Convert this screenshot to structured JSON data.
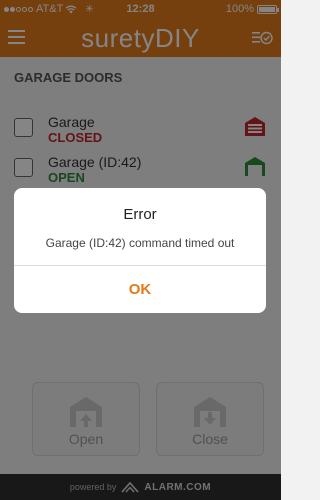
{
  "status_bar": {
    "carrier": "AT&T",
    "time": "12:28",
    "battery": "100%"
  },
  "header": {
    "brand_left": "surety",
    "brand_right": "DIY",
    "menu_icon": "hamburger-menu-icon",
    "task_icon": "task-check-icon"
  },
  "section": {
    "title": "GARAGE DOORS"
  },
  "doors": [
    {
      "name": "Garage",
      "status": "CLOSED",
      "status_color": "#c0282d",
      "icon": "garage-closed-icon"
    },
    {
      "name": "Garage (ID:42)",
      "status": "OPEN",
      "status_color": "#2e8b3a",
      "icon": "garage-open-icon"
    }
  ],
  "actions": {
    "open_label": "Open",
    "close_label": "Close"
  },
  "footer": {
    "powered_by": "powered by",
    "brand": "ALARM.COM"
  },
  "dialog": {
    "title": "Error",
    "message": "Garage (ID:42) command timed out",
    "ok_label": "OK"
  },
  "colors": {
    "accent": "#e2791c",
    "closed": "#c0282d",
    "open": "#2e8b3a"
  }
}
